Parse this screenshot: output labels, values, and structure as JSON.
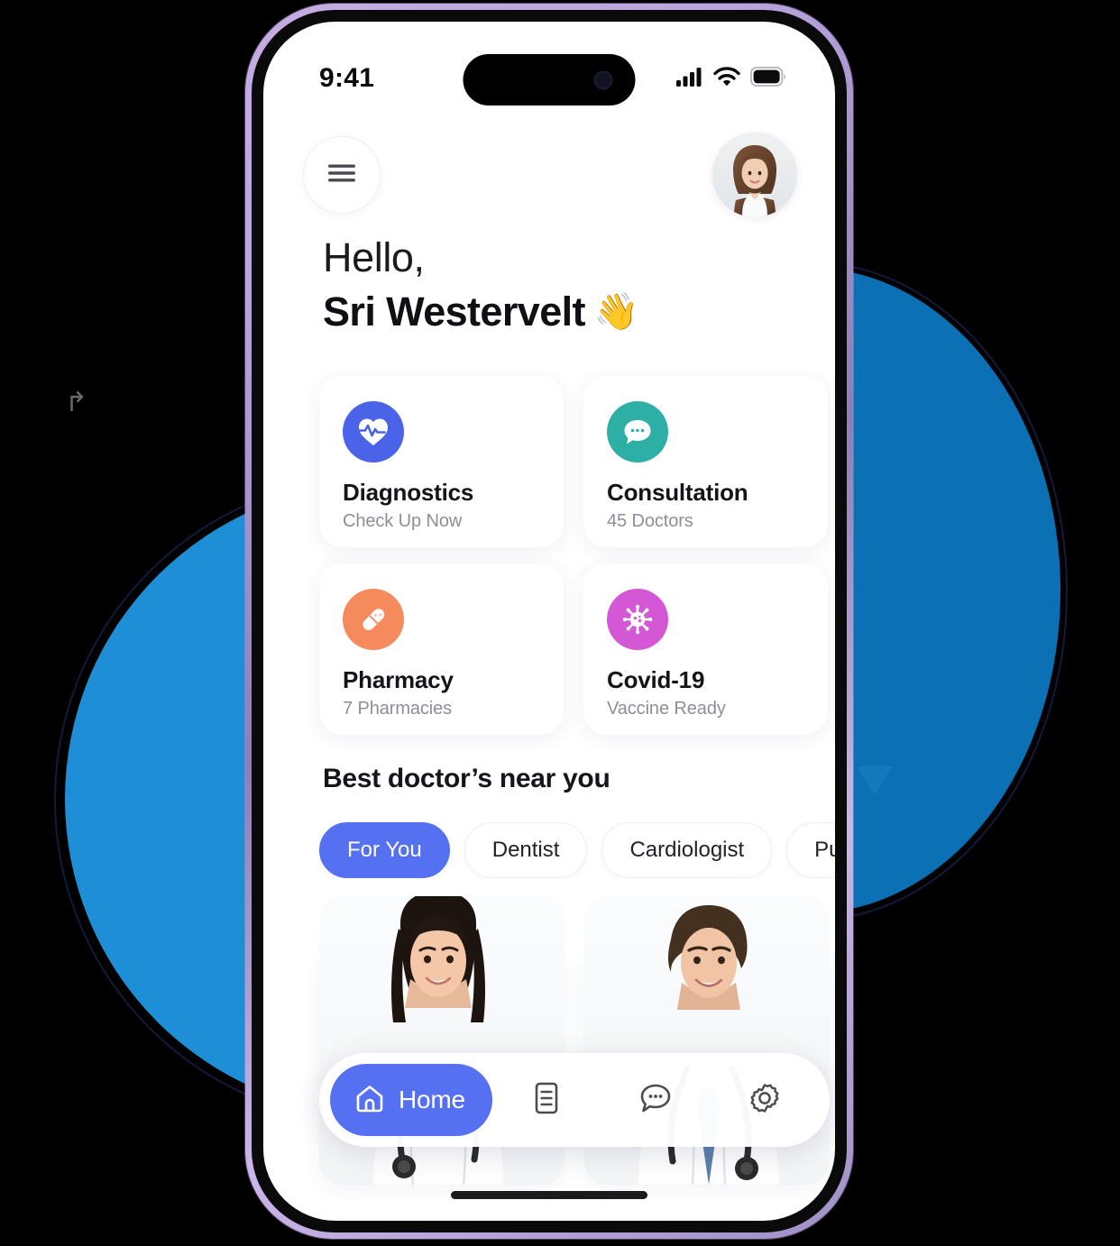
{
  "status_bar": {
    "time": "9:41",
    "cellular_icon": "signal-bars-icon",
    "wifi_icon": "wifi-icon",
    "battery_icon": "battery-full-icon"
  },
  "header": {
    "menu_icon": "hamburger-menu-icon",
    "avatar_icon": "user-avatar-photo"
  },
  "greeting": {
    "line1": "Hello,",
    "line2": "Sri Westervelt",
    "wave": "👋"
  },
  "services": [
    {
      "title": "Diagnostics",
      "subtitle": "Check Up Now",
      "icon": "heart-pulse-icon",
      "color": "#4A63E8"
    },
    {
      "title": "Consultation",
      "subtitle": "45 Doctors",
      "icon": "chat-bubble-icon",
      "color": "#2EAFA5"
    },
    {
      "title": "Pharmacy",
      "subtitle": "7 Pharmacies",
      "icon": "pill-capsule-icon",
      "color": "#F58A5C"
    },
    {
      "title": "Covid-19",
      "subtitle": "Vaccine Ready",
      "icon": "virus-icon",
      "color": "#D457D6"
    }
  ],
  "doctors_section": {
    "title": "Best doctor’s near you",
    "chips": [
      {
        "label": "For You",
        "active": true
      },
      {
        "label": "Dentist",
        "active": false
      },
      {
        "label": "Cardiologist",
        "active": false
      },
      {
        "label": "Pulmonol",
        "active": false
      }
    ],
    "cards": [
      {
        "photo": "female-doctor-photo"
      },
      {
        "photo": "male-doctor-photo"
      }
    ]
  },
  "bottom_nav": {
    "home_label": "Home",
    "items": [
      {
        "icon": "home-icon",
        "label": "Home",
        "active": true
      },
      {
        "icon": "document-icon",
        "active": false
      },
      {
        "icon": "chat-bubble-icon",
        "active": false
      },
      {
        "icon": "gear-icon",
        "active": false
      }
    ]
  },
  "decoration": {
    "cursor_glyph": "↱",
    "blob_left_color": "#1E8FD6",
    "blob_right_color": "#0C70B5",
    "accent_color": "#5570F1"
  }
}
